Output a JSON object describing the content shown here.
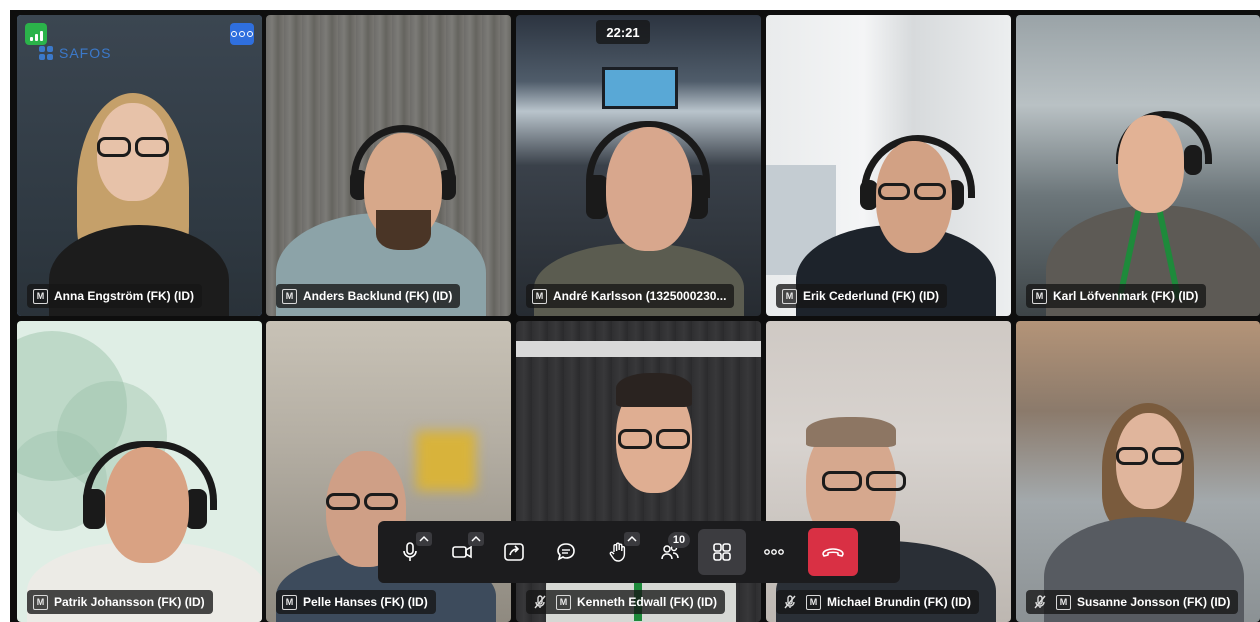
{
  "call": {
    "timer": "22:21",
    "logo_text": "SAFOS",
    "participant_count": "10",
    "colors": {
      "active_border": "#5b8fe6",
      "leave": "#d93044",
      "stats": "#2bb34a",
      "more": "#2f6fde"
    }
  },
  "participants": [
    {
      "name": "Anna Engström (FK) (ID)",
      "muted": false,
      "active": true
    },
    {
      "name": "Anders Backlund (FK) (ID)",
      "muted": false
    },
    {
      "name": "André Karlsson (1325000230...",
      "muted": false
    },
    {
      "name": "Erik Cederlund (FK) (ID)",
      "muted": false
    },
    {
      "name": "Karl Löfvenmark (FK) (ID)",
      "muted": false
    },
    {
      "name": "Patrik Johansson (FK) (ID)",
      "muted": false
    },
    {
      "name": "Pelle Hanses (FK) (ID)",
      "muted": false
    },
    {
      "name": "Kenneth Edwall (FK) (ID)",
      "muted": true
    },
    {
      "name": "Michael Brundin (FK) (ID)",
      "muted": true
    },
    {
      "name": "Susanne Jonsson (FK) (ID)",
      "muted": true
    }
  ],
  "badge_label": "M",
  "toolbar": {
    "buttons": [
      {
        "icon": "microphone-icon"
      },
      {
        "icon": "camera-icon"
      },
      {
        "icon": "share-screen-icon"
      },
      {
        "icon": "chat-icon"
      },
      {
        "icon": "raise-hand-icon"
      },
      {
        "icon": "participants-icon"
      },
      {
        "icon": "grid-view-icon"
      },
      {
        "icon": "more-options-icon"
      },
      {
        "icon": "leave-call-icon"
      }
    ]
  }
}
